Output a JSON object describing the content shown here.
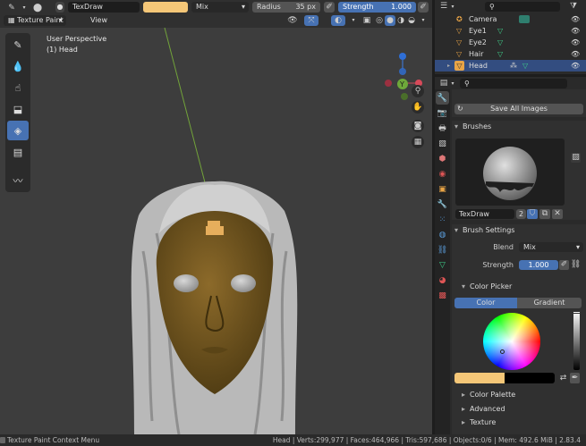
{
  "header": {
    "mode_label": "Texture Paint",
    "view_menu": "View",
    "brush_name": "TexDraw",
    "brush_color": "#f5c778",
    "blend_mode": "Mix",
    "radius_label": "Radius",
    "radius_value": "35 px",
    "strength_label": "Strength",
    "strength_value": "1.000"
  },
  "viewport": {
    "line1": "User Perspective",
    "line2": "(1) Head",
    "gizmo_axis": "Y"
  },
  "outliner": {
    "items": [
      {
        "label": "Camera"
      },
      {
        "label": "Eye1"
      },
      {
        "label": "Eye2"
      },
      {
        "label": "Hair"
      },
      {
        "label": "Head"
      }
    ]
  },
  "properties": {
    "save_all_images": "Save All Images",
    "brushes_header": "Brushes",
    "brush_name": "TexDraw",
    "brush_users": "2",
    "brush_settings_header": "Brush Settings",
    "blend_label": "Blend",
    "blend_value": "Mix",
    "strength_label": "Strength",
    "strength_value": "1.000",
    "color_picker_header": "Color Picker",
    "tab_color": "Color",
    "tab_gradient": "Gradient",
    "primary_color": "#f5c778",
    "secondary_color": "#000000",
    "color_palette_header": "Color Palette",
    "advanced_header": "Advanced",
    "texture_header": "Texture"
  },
  "statusbar": {
    "left": "Texture Paint Context Menu",
    "right": "Head | Verts:299,977 | Faces:464,966 | Tris:597,686 | Objects:0/6 | Mem: 492.6 MiB | 2.83.4"
  }
}
